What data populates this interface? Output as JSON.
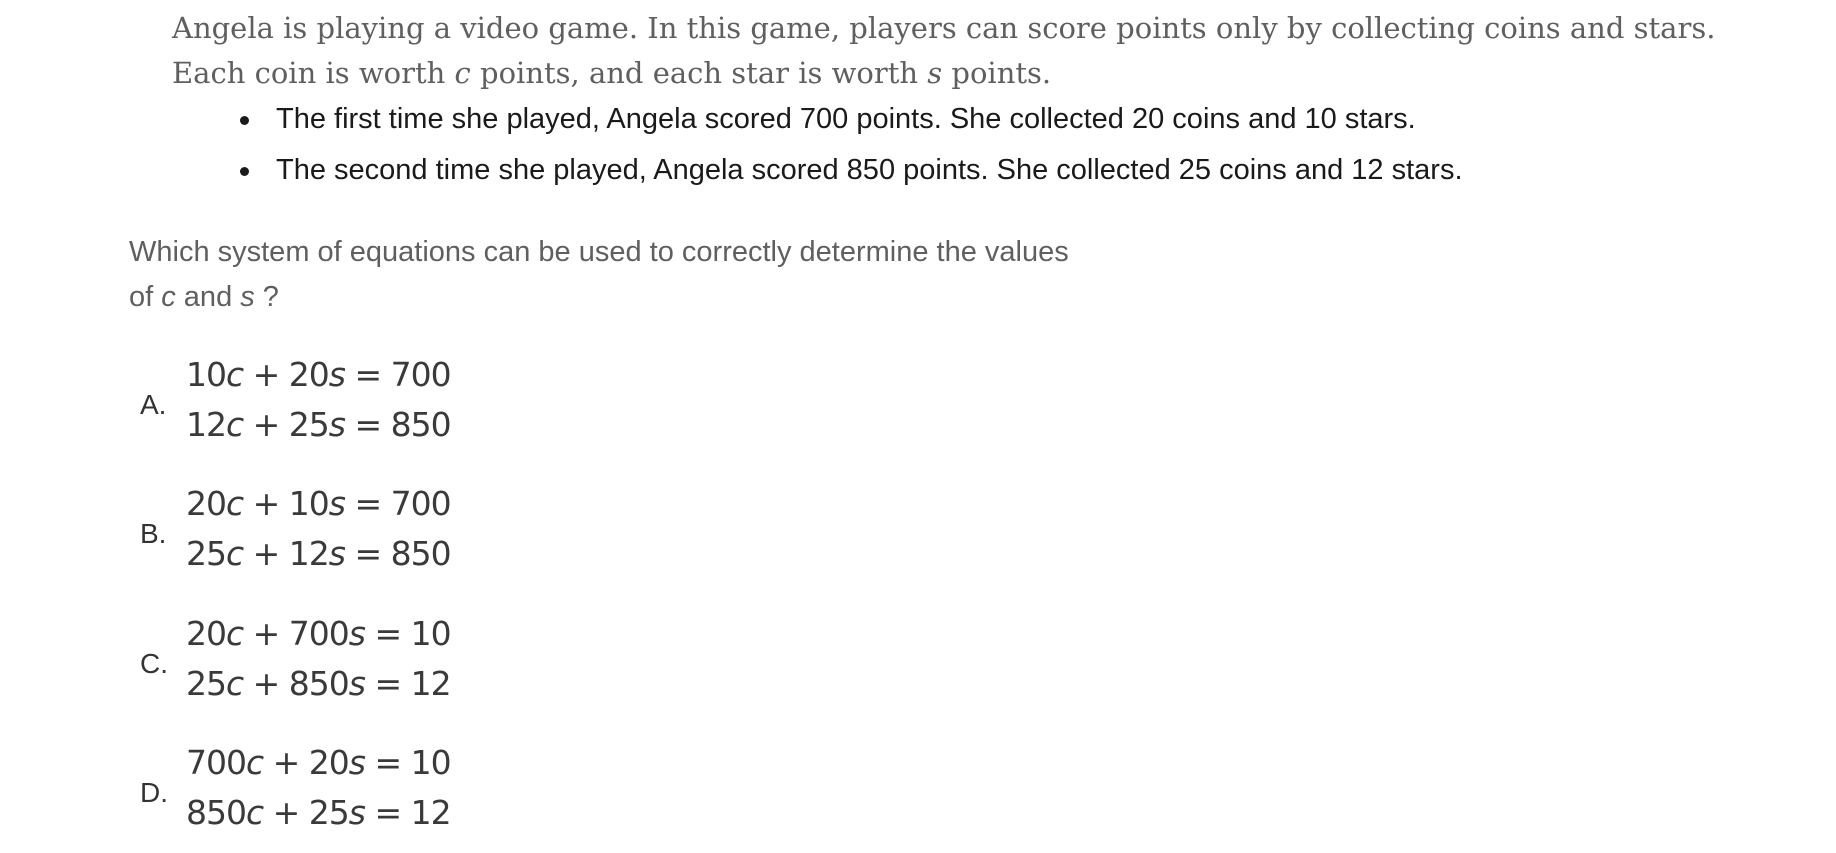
{
  "passage": {
    "line1": "Angela is playing a video game. In this game, players can score points only by collecting coins and stars.",
    "line2_before_c": "Each coin is worth ",
    "var_c": "c",
    "line2_middle": " points, and each star is worth ",
    "var_s": "s",
    "line2_after_s": " points."
  },
  "bullets": [
    "The first time she played, Angela scored 700 points. She collected 20 coins and 10 stars.",
    "The second time she played, Angela scored 850 points. She collected 25 coins and 12 stars."
  ],
  "question": {
    "line1": "Which system of equations can be used to correctly determine the values",
    "line2_prefix": "of ",
    "var_c": "c",
    "line2_and": " and ",
    "var_s": "s",
    "line2_suffix": " ?"
  },
  "choices": [
    {
      "letter": "A.",
      "eq1": {
        "coef1": "10",
        "v1": "c",
        "op": " + ",
        "coef2": "20",
        "v2": "s",
        "rhs": " = 700"
      },
      "eq2": {
        "coef1": "12",
        "v1": "c",
        "op": " + ",
        "coef2": "25",
        "v2": "s",
        "rhs": " = 850"
      }
    },
    {
      "letter": "B.",
      "eq1": {
        "coef1": "20",
        "v1": "c",
        "op": " + ",
        "coef2": "10",
        "v2": "s",
        "rhs": " = 700"
      },
      "eq2": {
        "coef1": "25",
        "v1": "c",
        "op": " + ",
        "coef2": "12",
        "v2": "s",
        "rhs": " = 850"
      }
    },
    {
      "letter": "C.",
      "eq1": {
        "coef1": "20",
        "v1": "c",
        "op": " + ",
        "coef2": "700",
        "v2": "s",
        "rhs": " = 10"
      },
      "eq2": {
        "coef1": "25",
        "v1": "c",
        "op": " + ",
        "coef2": "850",
        "v2": "s",
        "rhs": " = 12"
      }
    },
    {
      "letter": "D.",
      "eq1": {
        "coef1": "700",
        "v1": "c",
        "op": " + ",
        "coef2": "20",
        "v2": "s",
        "rhs": " = 10"
      },
      "eq2": {
        "coef1": "850",
        "v1": "c",
        "op": " + ",
        "coef2": "25",
        "v2": "s",
        "rhs": " = 12"
      }
    }
  ]
}
